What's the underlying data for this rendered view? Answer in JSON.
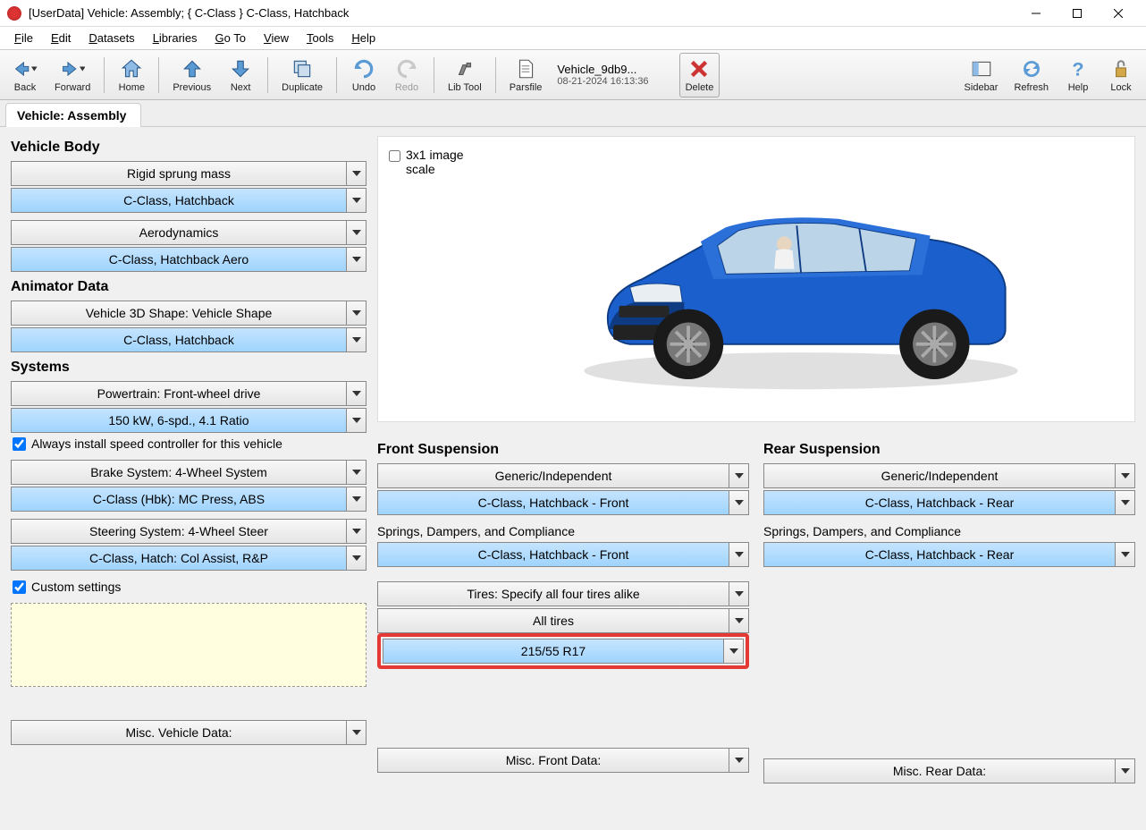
{
  "title": "[UserData] Vehicle: Assembly; { C-Class } C-Class, Hatchback",
  "menu": {
    "file": "File",
    "edit": "Edit",
    "datasets": "Datasets",
    "libraries": "Libraries",
    "goto": "Go To",
    "view": "View",
    "tools": "Tools",
    "help": "Help"
  },
  "toolbar": {
    "back": "Back",
    "forward": "Forward",
    "home": "Home",
    "previous": "Previous",
    "next": "Next",
    "duplicate": "Duplicate",
    "undo": "Undo",
    "redo": "Redo",
    "libtool": "Lib Tool",
    "parsfile": "Parsfile",
    "filename": "Vehicle_9db9...",
    "filedate": "08-21-2024 16:13:36",
    "delete": "Delete",
    "sidebar": "Sidebar",
    "refresh": "Refresh",
    "help": "Help",
    "lock": "Lock"
  },
  "tab": "Vehicle: Assembly",
  "left": {
    "body_title": "Vehicle Body",
    "rigid": "Rigid sprung mass",
    "rigid_val": "C-Class, Hatchback",
    "aero": "Aerodynamics",
    "aero_val": "C-Class, Hatchback Aero",
    "anim_title": "Animator Data",
    "shape": "Vehicle 3D Shape: Vehicle Shape",
    "shape_val": "C-Class, Hatchback",
    "systems_title": "Systems",
    "powertrain": "Powertrain: Front-wheel drive",
    "powertrain_val": "150 kW, 6-spd., 4.1 Ratio",
    "speed_ctrl": "Always install speed controller for this vehicle",
    "brake": "Brake System: 4-Wheel System",
    "brake_val": "C-Class (Hbk): MC Press, ABS",
    "steering": "Steering System: 4-Wheel Steer",
    "steering_val": "C-Class, Hatch: Col Assist, R&P",
    "custom": "Custom settings",
    "misc_vehicle": "Misc. Vehicle Data:"
  },
  "right": {
    "scale_check": "3x1 image scale",
    "front_title": "Front Suspension",
    "rear_title": "Rear Suspension",
    "front_type": "Generic/Independent",
    "front_val": "C-Class, Hatchback - Front",
    "rear_type": "Generic/Independent",
    "rear_val": "C-Class, Hatchback - Rear",
    "sdc_title": "Springs, Dampers, and Compliance",
    "sdc_front": "C-Class, Hatchback - Front",
    "sdc_rear": "C-Class, Hatchback - Rear",
    "tires": "Tires: Specify all four tires alike",
    "tires_all": "All tires",
    "tires_size": "215/55 R17",
    "misc_front": "Misc. Front Data:",
    "misc_rear": "Misc. Rear Data:"
  }
}
